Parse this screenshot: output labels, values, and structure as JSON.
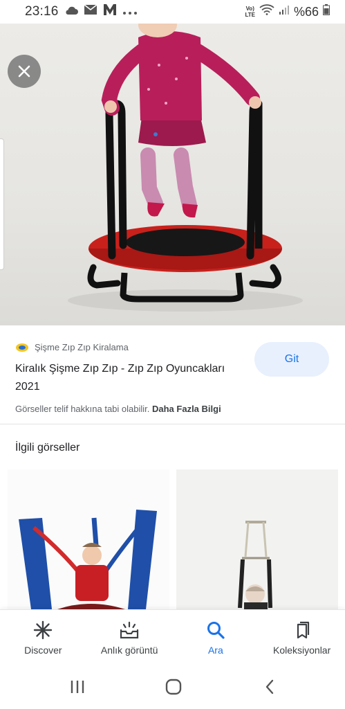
{
  "status_bar": {
    "time": "23:16",
    "network_label_top": "Vo)",
    "network_label_bottom": "LTE",
    "battery": "%66"
  },
  "hero": {
    "close_icon": "close-icon"
  },
  "source": {
    "name": "Şişme Zıp Zıp Kiralama",
    "title": "Kiralık Şişme Zıp Zıp - Zıp Zıp Oyuncakları 2021",
    "visit_label": "Git",
    "copyright_text": "Görseller telif hakkına tabi olabilir.",
    "more_info": "Daha Fazla Bilgi"
  },
  "related": {
    "title": "İlgili görseller"
  },
  "bottom_nav": {
    "items": [
      {
        "label": "Discover",
        "icon": "asterisk-icon",
        "active": false
      },
      {
        "label": "Anlık görüntü",
        "icon": "snapshot-tray-icon",
        "active": false
      },
      {
        "label": "Ara",
        "icon": "search-icon",
        "active": true
      },
      {
        "label": "Koleksiyonlar",
        "icon": "bookmarks-icon",
        "active": false
      }
    ]
  },
  "colors": {
    "accent": "#1a73e8",
    "visit_bg": "#e8f0fe",
    "trampoline_red": "#c8211c"
  }
}
